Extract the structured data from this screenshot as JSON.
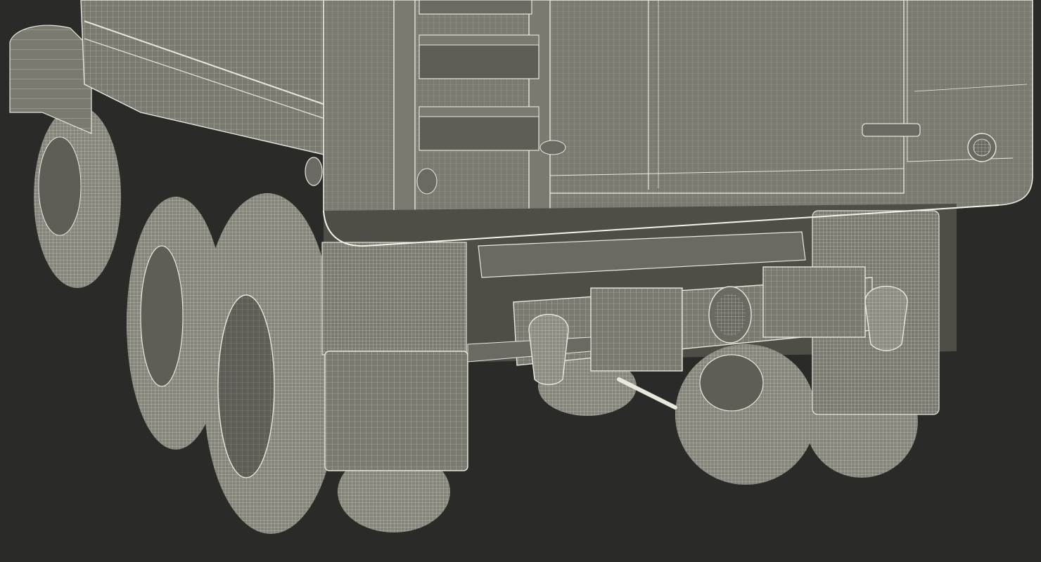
{
  "scene": {
    "background_color": "#2a2a28",
    "body_color": "#7a7a70",
    "body_shadow_color": "#4e4e47",
    "wire_color": "#e8e8dc",
    "tire_color": "#85857b"
  }
}
